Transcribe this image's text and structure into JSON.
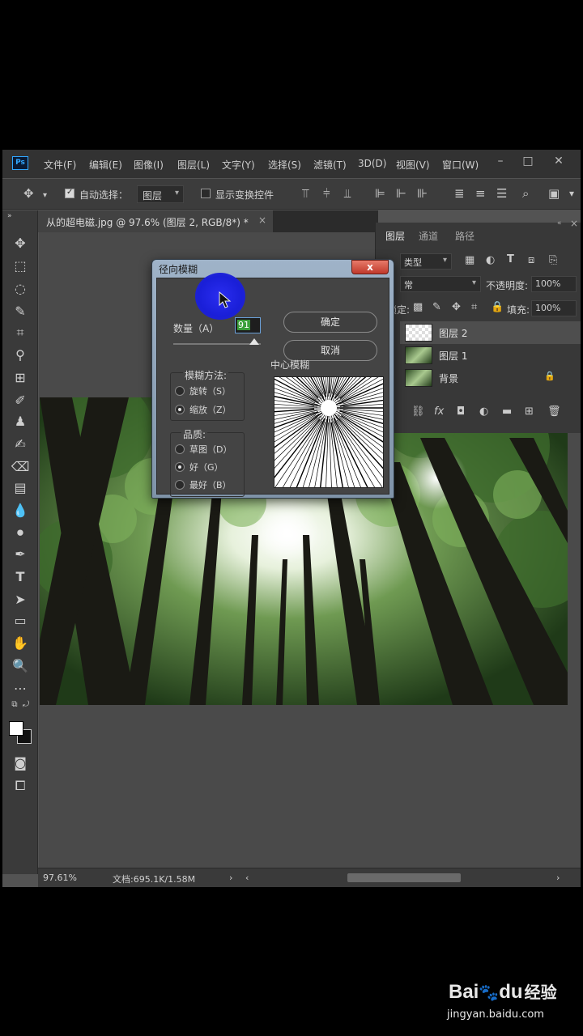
{
  "app": {
    "logo": "Ps",
    "menu": [
      "文件(F)",
      "编辑(E)",
      "图像(I)",
      "图层(L)",
      "文字(Y)",
      "选择(S)",
      "滤镜(T)",
      "3D(D)",
      "视图(V)",
      "窗口(W)"
    ],
    "window_controls": {
      "minimize": "–",
      "maximize": "□",
      "close": "✕"
    }
  },
  "options_bar": {
    "auto_select_label": "自动选择：",
    "auto_select_checked": true,
    "auto_select_target": "图层",
    "show_transform_label": "显示变换控件",
    "show_transform_checked": false
  },
  "document": {
    "tab_title": "从的超电磁.jpg @ 97.6% (图层 2, RGB/8*) *",
    "close": "×"
  },
  "layers_panel": {
    "tabs": [
      "图层",
      "通道",
      "路径"
    ],
    "active_tab": "图层",
    "filter_label": "类型",
    "blend_mode": "常",
    "opacity_label": "不透明度:",
    "opacity_value": "100%",
    "lock_label": "锁定:",
    "fill_label": "填充:",
    "fill_value": "100%",
    "layers": [
      {
        "name": "图层 2",
        "selected": true,
        "locked": false
      },
      {
        "name": "图层 1",
        "selected": false,
        "locked": false
      },
      {
        "name": "背景",
        "selected": false,
        "locked": true
      }
    ]
  },
  "status": {
    "zoom": "97.61%",
    "doc_info": "文档:695.1K/1.58M"
  },
  "dialog": {
    "title": "径向模糊",
    "close": "x",
    "amount_label": "数量（A）",
    "amount_value": "91",
    "ok_label": "确定",
    "cancel_label": "取消",
    "blur_method_title": "模糊方法:",
    "blur_methods": [
      {
        "label": "旋转（S）",
        "checked": false
      },
      {
        "label": "缩放（Z）",
        "checked": true
      }
    ],
    "quality_title": "品质:",
    "quality_options": [
      {
        "label": "草图（D）",
        "checked": false
      },
      {
        "label": "好（G）",
        "checked": true
      },
      {
        "label": "最好（B）",
        "checked": false
      }
    ],
    "center_label": "中心模糊"
  },
  "watermark": {
    "brand_latin": "Bai",
    "brand_latin_2": "du",
    "brand_cn": "经验",
    "url": "jingyan.baidu.com"
  }
}
